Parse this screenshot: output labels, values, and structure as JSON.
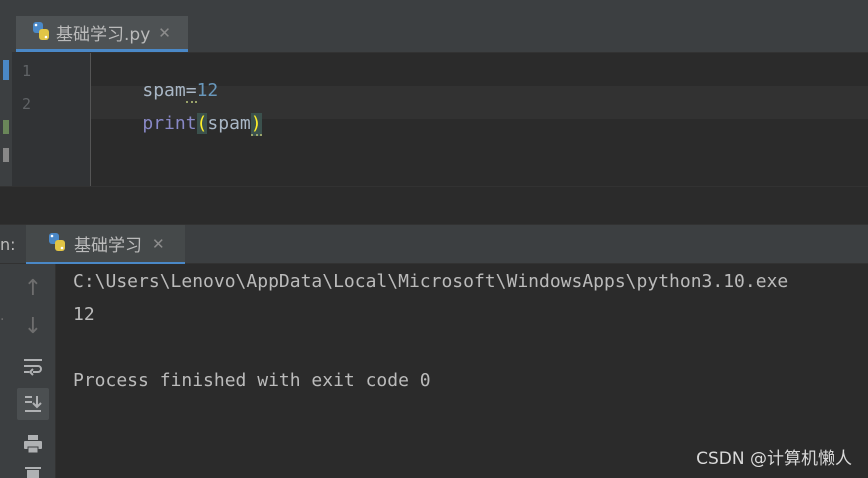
{
  "editor": {
    "tab": {
      "title": "基础学习.py",
      "close": "✕"
    },
    "lines": [
      {
        "number": "1",
        "code": "spam=12"
      },
      {
        "number": "2",
        "code": "print(spam)"
      }
    ],
    "line1": {
      "var": "spam",
      "op": "=",
      "num": "12"
    },
    "line2": {
      "fn": "print",
      "open": "(",
      "arg": "spam",
      "close": ")"
    }
  },
  "run": {
    "label": "n:",
    "tab": {
      "title": "基础学习",
      "close": "✕"
    },
    "toolbar": {
      "up": "↑",
      "down": "↓",
      "wrap": "soft-wrap-icon",
      "scroll_end": "scroll-to-end-icon",
      "print": "print-icon"
    },
    "output": [
      "C:\\Users\\Lenovo\\AppData\\Local\\Microsoft\\WindowsApps\\python3.10.exe",
      "12",
      "",
      "Process finished with exit code 0"
    ]
  },
  "watermark": "CSDN @计算机懒人",
  "colors": {
    "background": "#2b2b2b",
    "panel": "#3c3f41",
    "accent_tab_underline": "#4a88c7",
    "number": "#6897bb",
    "builtin": "#8888c6",
    "brace_match": "#ffef28"
  }
}
